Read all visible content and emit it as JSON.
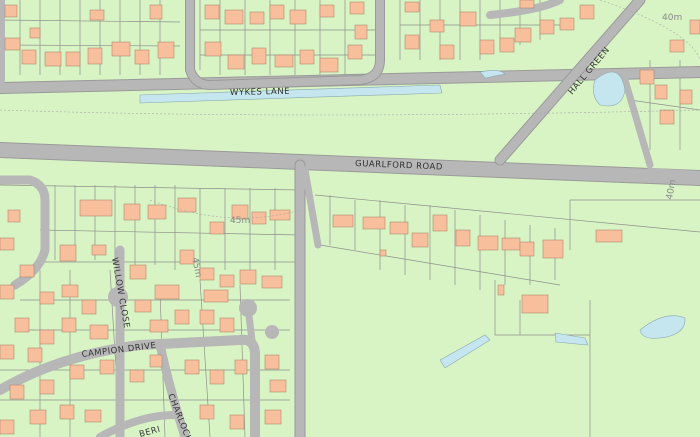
{
  "map": {
    "colors": {
      "land": "#d8f4c4",
      "road": "#b7b7b7",
      "road_edge": "#9a9a9a",
      "building": "#f7bf9b",
      "building_edge": "#b08870",
      "water": "#c5e6ee",
      "parcel_line": "#8f8f8f"
    },
    "road_labels": {
      "wykes_lane": "WYKES LANE",
      "guarlford_road": "GUARLFORD ROAD",
      "hall_green": "HALL GREEN",
      "willow_close": "WILLOW CLOSE",
      "campion_drive": "CAMPION DRIVE",
      "charlock": "CHARLOCK",
      "beri": "BERI"
    },
    "contours": {
      "c40_top": "40m",
      "c40_right": "40m",
      "c45_mid": "45m",
      "c45_rot": "45m"
    }
  }
}
